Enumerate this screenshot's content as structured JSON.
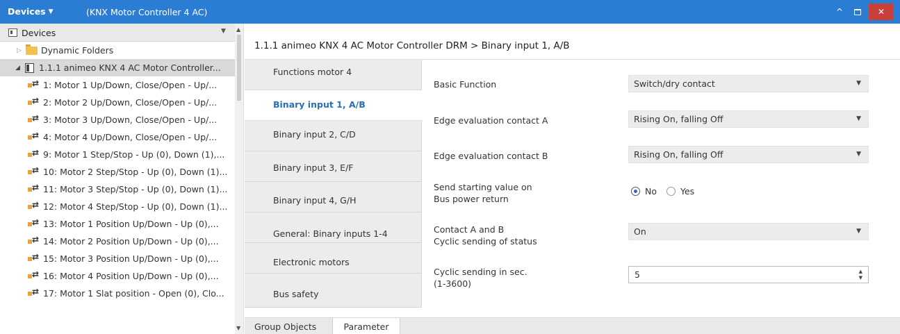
{
  "titlebar": {
    "menu_label": "Devices",
    "subtitle": "(KNX Motor Controller 4 AC)",
    "colors": {
      "bar": "#2b7cd3",
      "close": "#c9403a"
    }
  },
  "left_panel": {
    "header_label": "Devices",
    "tree": [
      {
        "label": "Dynamic Folders",
        "icon": "folder-icon"
      },
      {
        "label": "1.1.1 animeo KNX 4 AC Motor Controller...",
        "icon": "device-icon"
      },
      {
        "label": "1: Motor 1 Up/Down, Close/Open - Up/...",
        "icon": "group-object-icon"
      },
      {
        "label": "2: Motor 2 Up/Down, Close/Open - Up/...",
        "icon": "group-object-icon"
      },
      {
        "label": "3: Motor 3 Up/Down, Close/Open - Up/...",
        "icon": "group-object-icon"
      },
      {
        "label": "4: Motor 4 Up/Down, Close/Open - Up/...",
        "icon": "group-object-icon"
      },
      {
        "label": "9: Motor 1 Step/Stop - Up (0), Down (1),...",
        "icon": "group-object-icon"
      },
      {
        "label": "10: Motor 2 Step/Stop - Up (0), Down (1)...",
        "icon": "group-object-icon"
      },
      {
        "label": "11: Motor 3 Step/Stop - Up (0), Down (1)...",
        "icon": "group-object-icon"
      },
      {
        "label": "12: Motor 4 Step/Stop - Up (0), Down (1)...",
        "icon": "group-object-icon"
      },
      {
        "label": "13: Motor 1 Position Up/Down - Up (0),...",
        "icon": "group-object-icon"
      },
      {
        "label": "14: Motor 2 Position Up/Down - Up (0),...",
        "icon": "group-object-icon"
      },
      {
        "label": "15: Motor 3 Position Up/Down - Up (0),...",
        "icon": "group-object-icon"
      },
      {
        "label": "16: Motor 4 Position Up/Down - Up (0),...",
        "icon": "group-object-icon"
      },
      {
        "label": "17: Motor 1 Slat position - Open (0), Clo...",
        "icon": "group-object-icon"
      }
    ]
  },
  "content": {
    "title": "1.1.1 animeo KNX 4 AC Motor Controller DRM > Binary input 1, A/B",
    "param_tabs": [
      "Functions motor 4",
      "Binary input 1, A/B",
      "Binary input 2, C/D",
      "Binary input 3, E/F",
      "Binary input 4, G/H",
      "General: Binary inputs 1-4",
      "Electronic motors",
      "Bus safety"
    ],
    "active_tab": "Binary input 1, A/B",
    "params": {
      "basic_function": {
        "label": "Basic Function",
        "value": "Switch/dry contact"
      },
      "edge_a": {
        "label": "Edge evaluation contact A",
        "value": "Rising On, falling Off"
      },
      "edge_b": {
        "label": "Edge evaluation contact B",
        "value": "Rising On, falling Off"
      },
      "send_start": {
        "label_line1": "Send starting value on",
        "label_line2": "Bus power return",
        "options": [
          "No",
          "Yes"
        ],
        "selected": "No"
      },
      "cyclic_status": {
        "label_line1": "Contact A and B",
        "label_line2": "Cyclic sending of status",
        "value": "On"
      },
      "cyclic_sec": {
        "label_line1": "Cyclic sending in sec.",
        "label_line2": "(1-3600)",
        "value": "5"
      }
    },
    "accent_color": "#2a6eb3"
  },
  "bottom_tabs": [
    "Group Objects",
    "Parameter"
  ],
  "active_bottom_tab": "Parameter"
}
